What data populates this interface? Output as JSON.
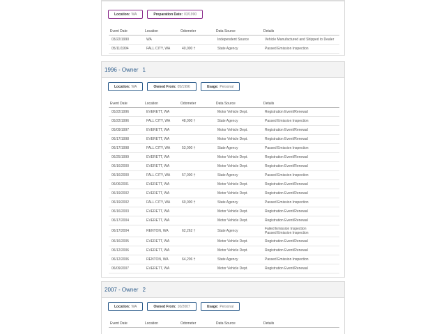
{
  "headers": [
    "Event Date",
    "Location",
    "Odometer",
    "Data Source",
    "Details"
  ],
  "card0": {
    "pills": [
      {
        "label": "Location:",
        "value": "WA"
      },
      {
        "label": "Preparation Date:",
        "value": "03/1990"
      }
    ],
    "rows": [
      [
        "03/22/1990",
        "WA",
        "",
        "Independent Source",
        "Vehicle Manufactured and Shipped to Dealer"
      ],
      [
        "05/11/1994",
        "FALL CITY, WA",
        "40,000 †",
        "State Agency",
        "Passed Emission Inspection"
      ]
    ]
  },
  "card1": {
    "year": "1996 - Owner",
    "owner_num": "1",
    "pills": [
      {
        "label": "Location:",
        "value": "WA"
      },
      {
        "label": "Owned From:",
        "value": "05/1996"
      },
      {
        "label": "Usage:",
        "value": "Personal"
      }
    ],
    "rows": [
      [
        "05/22/1996",
        "EVERETT, WA",
        "",
        "Motor Vehicle Dept.",
        "Registration Event/Renewal"
      ],
      [
        "05/22/1996",
        "FALL CITY, WA",
        "48,000 †",
        "State Agency",
        "Passed Emission Inspection"
      ],
      [
        "05/09/1997",
        "EVERETT, WA",
        "",
        "Motor Vehicle Dept.",
        "Registration Event/Renewal"
      ],
      [
        "06/17/1998",
        "EVERETT, WA",
        "",
        "Motor Vehicle Dept.",
        "Registration Event/Renewal"
      ],
      [
        "06/17/1998",
        "FALL CITY, WA",
        "53,000 †",
        "State Agency",
        "Passed Emission Inspection"
      ],
      [
        "06/25/1999",
        "EVERETT, WA",
        "",
        "Motor Vehicle Dept.",
        "Registration Event/Renewal"
      ],
      [
        "06/16/2000",
        "EVERETT, WA",
        "",
        "Motor Vehicle Dept.",
        "Registration Event/Renewal"
      ],
      [
        "06/16/2000",
        "FALL CITY, WA",
        "57,000 †",
        "State Agency",
        "Passed Emission Inspection"
      ],
      [
        "06/06/2001",
        "EVERETT, WA",
        "",
        "Motor Vehicle Dept.",
        "Registration Event/Renewal"
      ],
      [
        "06/19/2002",
        "EVERETT, WA",
        "",
        "Motor Vehicle Dept.",
        "Registration Event/Renewal"
      ],
      [
        "06/19/2002",
        "FALL CITY, WA",
        "60,000 †",
        "State Agency",
        "Passed Emission Inspection"
      ],
      [
        "06/16/2003",
        "EVERETT, WA",
        "",
        "Motor Vehicle Dept.",
        "Registration Event/Renewal"
      ],
      [
        "06/17/2004",
        "EVERETT, WA",
        "",
        "Motor Vehicle Dept.",
        "Registration Event/Renewal"
      ],
      [
        "06/17/2004",
        "RENTON, WA",
        "62,262 †",
        "State Agency",
        "Failed Emission Inspection\nPassed Emission Inspection"
      ],
      [
        "06/16/2005",
        "EVERETT, WA",
        "",
        "Motor Vehicle Dept.",
        "Registration Event/Renewal"
      ],
      [
        "06/12/2006",
        "EVERETT, WA",
        "",
        "Motor Vehicle Dept.",
        "Registration Event/Renewal"
      ],
      [
        "06/12/2006",
        "RENTON, WA",
        "64,206 †",
        "State Agency",
        "Passed Emission Inspection"
      ],
      [
        "06/09/2007",
        "EVERETT, WA",
        "",
        "Motor Vehicle Dept.",
        "Registration Event/Renewal"
      ]
    ]
  },
  "card2": {
    "year": "2007 - Owner",
    "owner_num": "2",
    "pills": [
      {
        "label": "Location:",
        "value": "WA"
      },
      {
        "label": "Owned From:",
        "value": "10/2007"
      },
      {
        "label": "Usage:",
        "value": "Personal"
      }
    ]
  },
  "colors": {
    "blue_border": "#2a5a8a",
    "purple_border": "#8a2a8a",
    "card_bg": "#f3f3f3"
  }
}
